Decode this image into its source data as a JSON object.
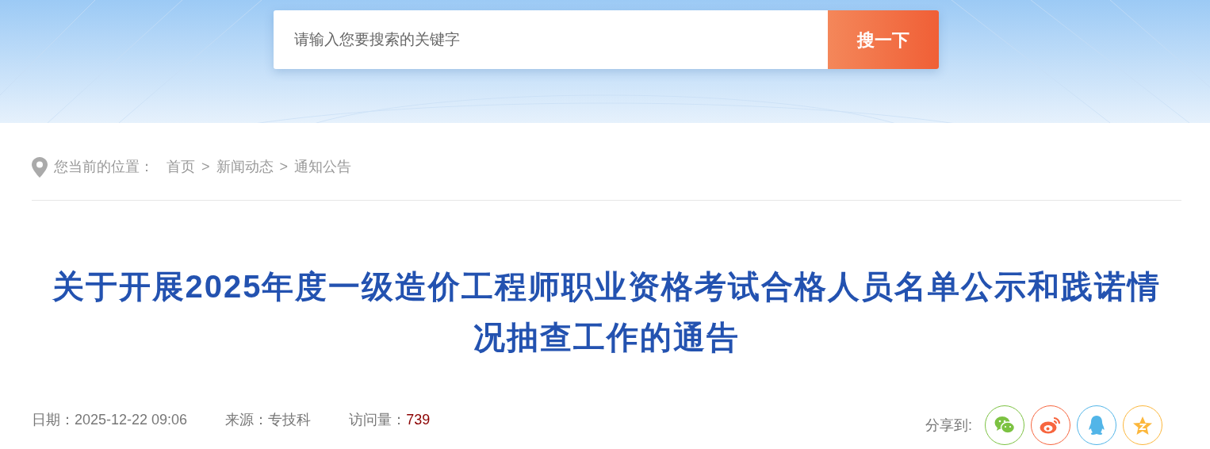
{
  "search": {
    "placeholder": "请输入您要搜索的关键字",
    "button": "搜一下"
  },
  "breadcrumb": {
    "label": "您当前的位置：",
    "separator": ">",
    "items": [
      "首页",
      "新闻动态",
      "通知公告"
    ]
  },
  "article": {
    "title": "关于开展2025年度一级造价工程师职业资格考试合格人员名单公示和践诺情况抽查工作的通告",
    "meta": [
      {
        "label": "日期：",
        "value": "2025-12-22 09:06",
        "kind": "plain"
      },
      {
        "label": "来源：",
        "value": "专技科",
        "kind": "plain"
      },
      {
        "label": "访问量：",
        "value": "739",
        "kind": "count"
      }
    ]
  },
  "share": {
    "label": "分享到:",
    "targets": [
      {
        "kind": "chat",
        "color": "#7cc242"
      },
      {
        "kind": "weibo",
        "color": "#f7663f"
      },
      {
        "kind": "penguin",
        "color": "#52b5e8"
      },
      {
        "kind": "star",
        "color": "#fcb73c"
      }
    ]
  }
}
